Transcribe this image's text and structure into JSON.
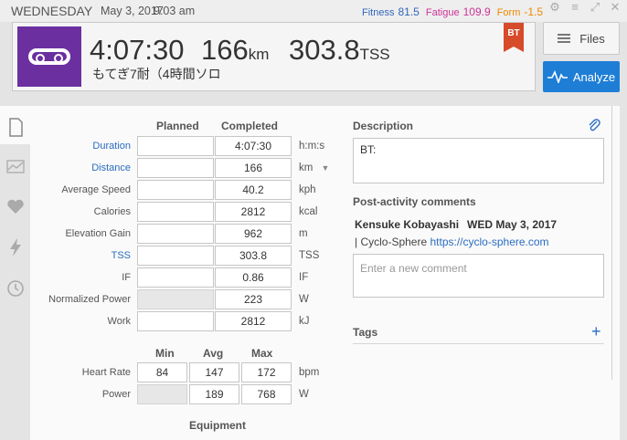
{
  "topbar": {
    "day": "WEDNESDAY",
    "date": "May 3, 2017",
    "time": "9:03 am",
    "fitness_label": "Fitness",
    "fitness_value": "81.5",
    "fatigue_label": "Fatigue",
    "fatigue_value": "109.9",
    "form_label": "Form",
    "form_value": "-1.5"
  },
  "header": {
    "duration": "4:07:30",
    "distance": "166",
    "distance_unit": "km",
    "tss": "303.8",
    "tss_unit": "TSS",
    "title": "もてぎ7耐（4時間ソロ",
    "badge": "BT",
    "sport_icon": "bike-chain-icon"
  },
  "buttons": {
    "files": "Files",
    "analyze": "Analyze"
  },
  "workout": {
    "planned_header": "Planned",
    "completed_header": "Completed",
    "rows": [
      {
        "label": "Duration",
        "planned": "",
        "completed": "4:07:30",
        "unit": "h:m:s"
      },
      {
        "label": "Distance",
        "planned": "",
        "completed": "166",
        "unit": "km"
      },
      {
        "label": "Average Speed",
        "planned": "",
        "completed": "40.2",
        "unit": "kph"
      },
      {
        "label": "Calories",
        "planned": "",
        "completed": "2812",
        "unit": "kcal"
      },
      {
        "label": "Elevation Gain",
        "planned": "",
        "completed": "962",
        "unit": "m"
      },
      {
        "label": "TSS",
        "planned": "",
        "completed": "303.8",
        "unit": "TSS"
      },
      {
        "label": "IF",
        "planned": "",
        "completed": "0.86",
        "unit": "IF"
      },
      {
        "label": "Normalized Power",
        "planned": "",
        "completed": "223",
        "unit": "W"
      },
      {
        "label": "Work",
        "planned": "",
        "completed": "2812",
        "unit": "kJ"
      }
    ],
    "min_header": "Min",
    "avg_header": "Avg",
    "max_header": "Max",
    "hr_label": "Heart Rate",
    "hr_min": "84",
    "hr_avg": "147",
    "hr_max": "172",
    "hr_unit": "bpm",
    "power_label": "Power",
    "power_min": "",
    "power_avg": "189",
    "power_max": "768",
    "power_unit": "W",
    "equipment_header": "Equipment"
  },
  "description": {
    "header": "Description",
    "text": "BT:"
  },
  "comments": {
    "header": "Post-activity comments",
    "author": "Kensuke Kobayashi",
    "date": "WED May 3, 2017",
    "body_prefix": "| Cyclo-Sphere",
    "body_link": "https://cyclo-sphere.com",
    "placeholder": "Enter a new comment"
  },
  "tags": {
    "header": "Tags",
    "add": "+"
  },
  "colors": {
    "accent": "#1e7ed6",
    "sport": "#6b2fa0",
    "badge": "#d64b2a",
    "fitness": "#3366bb",
    "fatigue": "#cc3399",
    "form": "#ee8800"
  }
}
